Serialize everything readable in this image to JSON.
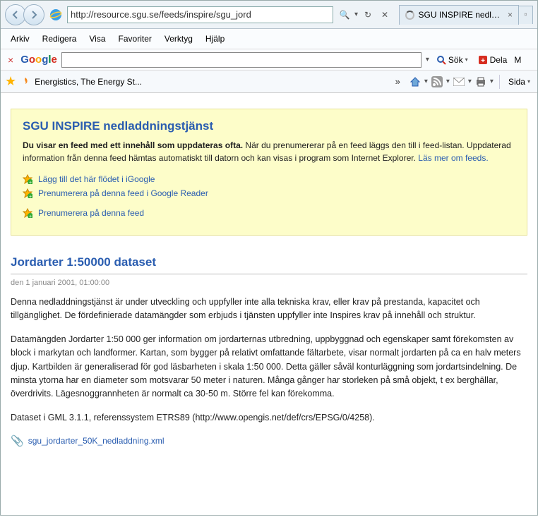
{
  "address_bar": {
    "url": "http://resource.sgu.se/feeds/inspire/sgu_jord",
    "search_glyph": "🔍",
    "refresh_glyph": "↻",
    "stop_glyph": "✕"
  },
  "tab": {
    "title": "SGU INSPIRE nedlad...",
    "close": "×"
  },
  "menu": {
    "arkiv": "Arkiv",
    "redigera": "Redigera",
    "visa": "Visa",
    "favoriter": "Favoriter",
    "verktyg": "Verktyg",
    "hjalp": "Hjälp"
  },
  "google_bar": {
    "sok": "Sök",
    "dela": "Dela",
    "mer": "M"
  },
  "fav_bar": {
    "link1": "Energistics, The Energy St...",
    "sida": "Sida"
  },
  "feed": {
    "title": "SGU INSPIRE nedladdningstjänst",
    "desc_bold": "Du visar en feed med ett innehåll som uppdateras ofta.",
    "desc_rest": " När du prenumererar på en feed läggs den till i feed-listan. Uppdaterad information från denna feed hämtas automatiskt till datorn och kan visas i program som Internet Explorer. ",
    "learn_more": "Läs mer om feeds.",
    "link_igoogle": "Lägg till det här flödet i iGoogle",
    "link_greader": "Prenumerera på denna feed i Google Reader",
    "link_sub": "Prenumerera på denna feed"
  },
  "entry": {
    "title": "Jordarter 1:50000 dataset",
    "date": "den 1 januari 2001, 01:00:00",
    "p1": "Denna nedladdningstjänst är under utveckling och uppfyller inte alla tekniska krav, eller krav på prestanda, kapacitet och tillgänglighet. De fördefinierade datamängder som erbjuds i tjänsten uppfyller inte Inspires krav på innehåll och struktur.",
    "p2": "Datamängden Jordarter 1:50 000 ger information om jordarternas utbredning, uppbyggnad och egenskaper samt förekomsten av block i markytan och landformer. Kartan, som bygger på relativt omfattande fältarbete, visar normalt jordarten på ca en halv meters djup. Kartbilden är generaliserad för god läsbarheten i skala 1:50 000. Detta gäller såväl konturläggning som jordartsindelning. De minsta ytorna har en diameter som motsvarar 50 meter i naturen. Många gånger har storleken på små objekt, t ex berghällar, överdrivits. Lägesnoggrannheten är normalt ca 30-50 m. Större fel kan förekomma.",
    "p3": "Dataset i GML 3.1.1, referenssystem ETRS89 (http://www.opengis.net/def/crs/EPSG/0/4258).",
    "attachment": "sgu_jordarter_50K_nedladdning.xml"
  }
}
